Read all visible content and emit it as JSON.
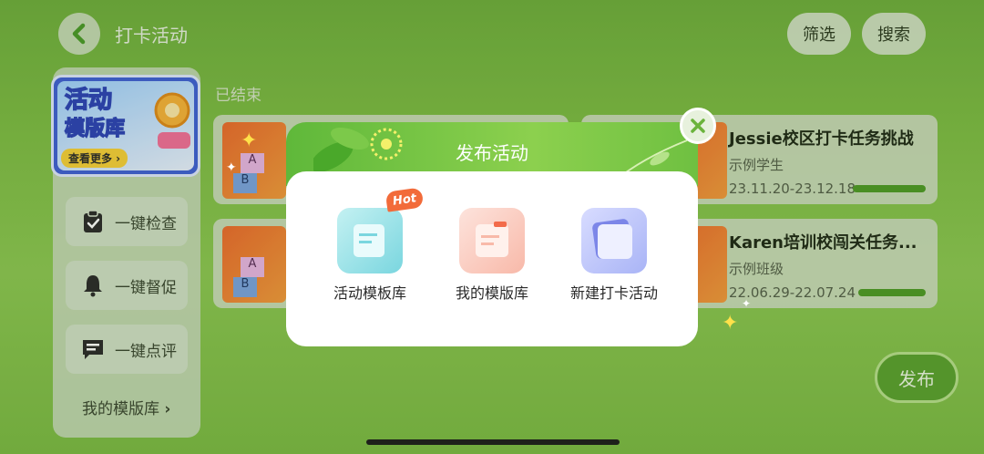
{
  "header": {
    "title": "打卡活动",
    "filter_label": "筛选",
    "search_label": "搜索"
  },
  "sidebar": {
    "banner": {
      "line1": "活动",
      "line2": "模版库",
      "more": "查看更多 ›"
    },
    "buttons": [
      {
        "label": "一键检查",
        "icon": "clipboard-check-icon"
      },
      {
        "label": "一键督促",
        "icon": "bell-icon"
      },
      {
        "label": "一键点评",
        "icon": "comment-icon"
      }
    ],
    "link": "我的模版库"
  },
  "content": {
    "status": "已结束",
    "cards": [
      {
        "title": "Jessie校区打卡任务挑战",
        "subtitle": "示例学生",
        "date": "23.11.20-23.12.18"
      },
      {
        "title": "Karen培训校闯关任务...",
        "subtitle": "示例班级",
        "date": "22.06.29-22.07.24"
      }
    ],
    "thumb_letters": [
      "A",
      "B"
    ]
  },
  "publish_label": "发布",
  "modal": {
    "title": "发布活动",
    "badge": "Hot",
    "options": [
      {
        "label": "活动模板库",
        "icon": "template-icon"
      },
      {
        "label": "我的模版库",
        "icon": "my-template-icon"
      },
      {
        "label": "新建打卡活动",
        "icon": "new-activity-icon"
      }
    ]
  },
  "colors": {
    "accent": "#5aa12f",
    "hot": "#f26b3a",
    "progress": "#4e9a26"
  }
}
